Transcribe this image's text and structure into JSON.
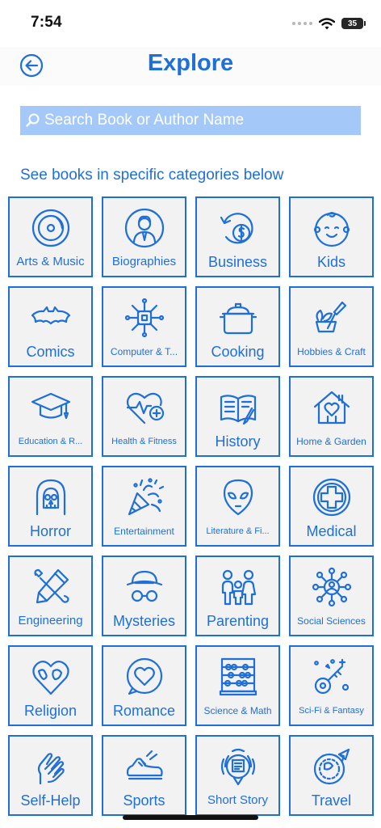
{
  "status_bar": {
    "time": "7:54",
    "battery": "35"
  },
  "header": {
    "title": "Explore"
  },
  "search": {
    "placeholder": "Search Book or Author Name"
  },
  "section_label": "See books in specific categories below",
  "colors": {
    "accent": "#1f6fd8",
    "search_bg": "#a4c8f8",
    "tile_bg": "#f2f2f2"
  },
  "categories": [
    {
      "label": "Arts & Music",
      "icon": "vinyl-record-icon"
    },
    {
      "label": "Biographies",
      "icon": "person-portrait-icon"
    },
    {
      "label": "Business",
      "icon": "coin-arrow-icon"
    },
    {
      "label": "Kids",
      "icon": "baby-face-icon"
    },
    {
      "label": "Comics",
      "icon": "bat-emblem-icon"
    },
    {
      "label": "Computer & T...",
      "icon": "circuit-chip-icon"
    },
    {
      "label": "Cooking",
      "icon": "cooking-pot-icon"
    },
    {
      "label": "Hobbies & Craft",
      "icon": "garden-tools-icon"
    },
    {
      "label": "Education & R...",
      "icon": "graduation-cap-icon"
    },
    {
      "label": "Health & Fitness",
      "icon": "heart-pulse-icon"
    },
    {
      "label": "History",
      "icon": "open-book-icon"
    },
    {
      "label": "Home & Garden",
      "icon": "house-heart-icon"
    },
    {
      "label": "Horror",
      "icon": "skull-hood-icon"
    },
    {
      "label": "Entertainment",
      "icon": "party-popper-icon"
    },
    {
      "label": "Literature & Fi...",
      "icon": "alien-head-icon"
    },
    {
      "label": "Medical",
      "icon": "medical-cross-icon"
    },
    {
      "label": "Engineering",
      "icon": "tools-icon"
    },
    {
      "label": "Mysteries",
      "icon": "detective-icon"
    },
    {
      "label": "Parenting",
      "icon": "family-icon"
    },
    {
      "label": "Social Sciences",
      "icon": "social-network-icon"
    },
    {
      "label": "Religion",
      "icon": "heart-globe-icon"
    },
    {
      "label": "Romance",
      "icon": "heart-bubble-icon"
    },
    {
      "label": "Science & Math",
      "icon": "abacus-icon"
    },
    {
      "label": "Sci-Fi & Fantasy",
      "icon": "space-key-icon"
    },
    {
      "label": "Self-Help",
      "icon": "helping-hands-icon"
    },
    {
      "label": "Sports",
      "icon": "running-shoe-icon"
    },
    {
      "label": "Short Story",
      "icon": "story-radio-icon"
    },
    {
      "label": "Travel",
      "icon": "globe-plane-icon"
    }
  ]
}
